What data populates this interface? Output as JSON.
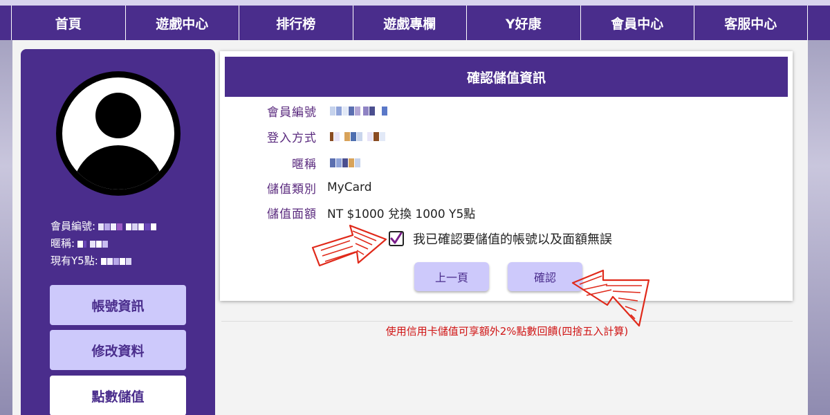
{
  "nav": {
    "items": [
      "首頁",
      "遊戲中心",
      "排行榜",
      "遊戲專欄",
      "Y好康",
      "會員中心",
      "客服中心"
    ]
  },
  "sidebar": {
    "member_id_label": "會員編號:",
    "nickname_label": "暱稱:",
    "points_label": "現有Y5點:",
    "buttons": [
      "帳號資訊",
      "修改資料",
      "點數儲值"
    ],
    "active_button": "點數儲值"
  },
  "panel": {
    "title": "確認儲值資訊",
    "rows": [
      {
        "label": "會員編號",
        "value": ""
      },
      {
        "label": "登入方式",
        "value": ""
      },
      {
        "label": "暱稱",
        "value": ""
      },
      {
        "label": "儲值類別",
        "value": "MyCard"
      },
      {
        "label": "儲值面額",
        "value": "NT $1000 兌換 1000 Y5點"
      }
    ],
    "confirm_text": "我已確認要儲值的帳號以及面額無誤",
    "confirm_checked": true,
    "back_button": "上一頁",
    "confirm_button": "確認"
  },
  "notice": "使用信用卡儲值可享額外2%點數回饋(四捨五入計算)",
  "colors": {
    "brand_purple": "#4a2d8c",
    "button_lavender": "#cdc9fb",
    "label_purple": "#5a2a7e",
    "notice_red": "#d01515",
    "annotation_red": "#e0291a"
  },
  "icons": {
    "avatar": "user-avatar-icon",
    "checkbox": "checkmark-icon",
    "annotation": "hand-drawn-red-arrow"
  }
}
